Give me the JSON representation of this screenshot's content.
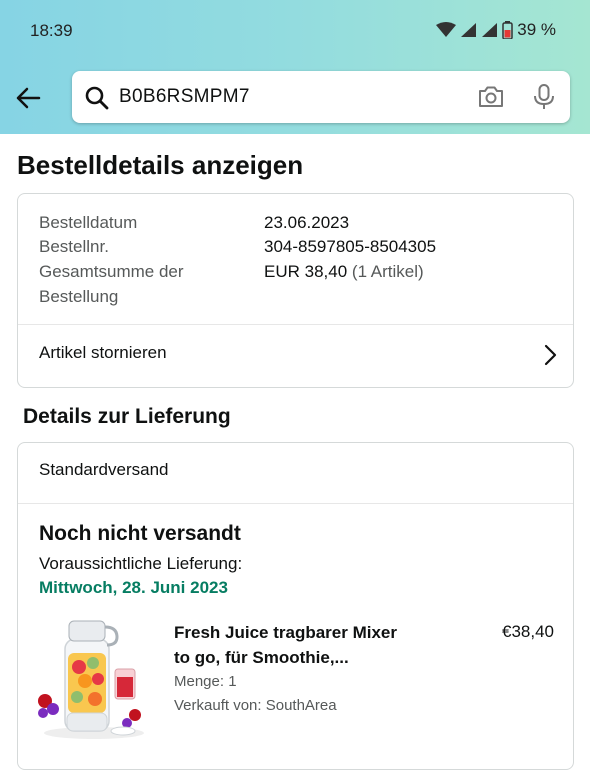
{
  "status_bar": {
    "time": "18:39",
    "battery": "39 %"
  },
  "search": {
    "query": "B0B6RSMPM7"
  },
  "page_title": "Bestelldetails anzeigen",
  "order": {
    "date_label": "Bestelldatum",
    "date_value": "23.06.2023",
    "number_label": "Bestellnr.",
    "number_value": "304-8597805-8504305",
    "total_label_1": "Gesamtsumme der",
    "total_label_2": "Bestellung",
    "total_value": "EUR 38,40",
    "total_items": "(1 Artikel)",
    "cancel_label": "Artikel stornieren"
  },
  "delivery": {
    "heading": "Details zur Lieferung",
    "shipping_method": "Standardversand",
    "status": "Noch nicht versandt",
    "eta_label": "Voraussichtliche Lieferung:",
    "eta_date": "Mittwoch, 28. Juni 2023",
    "eta_color": "#067d62"
  },
  "product": {
    "title_line1": "Fresh Juice tragbarer Mixer",
    "title_line2": "to go, für Smoothie,...",
    "price": "€38,40",
    "quantity": "Menge: 1",
    "seller": "Verkauft von: SouthArea"
  }
}
